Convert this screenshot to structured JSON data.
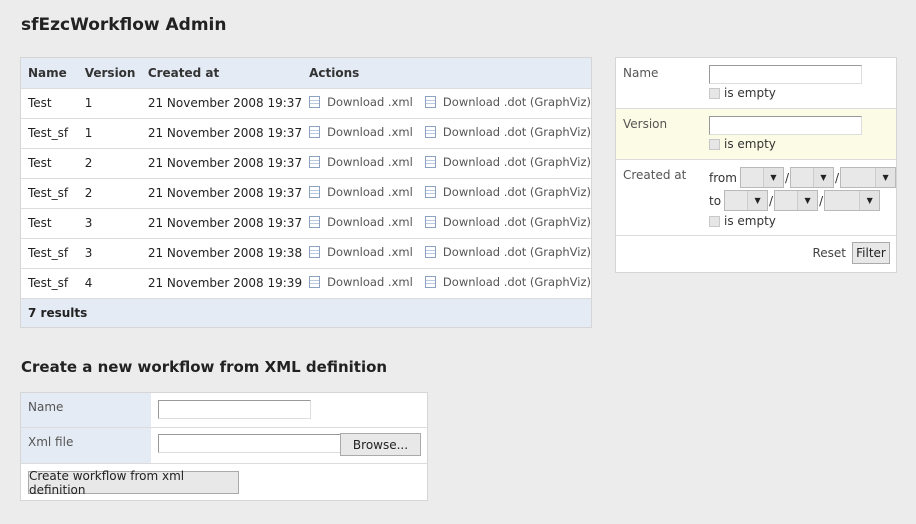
{
  "page": {
    "title": "sfEzcWorkflow Admin"
  },
  "list": {
    "columns": [
      "Name",
      "Version",
      "Created at",
      "Actions"
    ],
    "download_xml_label": "Download .xml",
    "download_dot_label": "Download .dot (GraphViz)",
    "rows": [
      {
        "name": "Test",
        "version": "1",
        "created_at": "21 November 2008 19:37"
      },
      {
        "name": "Test_sf",
        "version": "1",
        "created_at": "21 November 2008 19:37"
      },
      {
        "name": "Test",
        "version": "2",
        "created_at": "21 November 2008 19:37"
      },
      {
        "name": "Test_sf",
        "version": "2",
        "created_at": "21 November 2008 19:37"
      },
      {
        "name": "Test",
        "version": "3",
        "created_at": "21 November 2008 19:37"
      },
      {
        "name": "Test_sf",
        "version": "3",
        "created_at": "21 November 2008 19:38"
      },
      {
        "name": "Test_sf",
        "version": "4",
        "created_at": "21 November 2008 19:39"
      }
    ],
    "results_text": "7 results"
  },
  "filter": {
    "name_label": "Name",
    "version_label": "Version",
    "created_at_label": "Created at",
    "is_empty_label": "is empty",
    "from_label": "from",
    "to_label": "to",
    "reset_label": "Reset",
    "filter_button": "Filter"
  },
  "create": {
    "heading": "Create a new workflow from XML definition",
    "name_label": "Name",
    "xml_file_label": "Xml file",
    "browse_button": "Browse...",
    "submit_button": "Create workflow from xml definition"
  }
}
